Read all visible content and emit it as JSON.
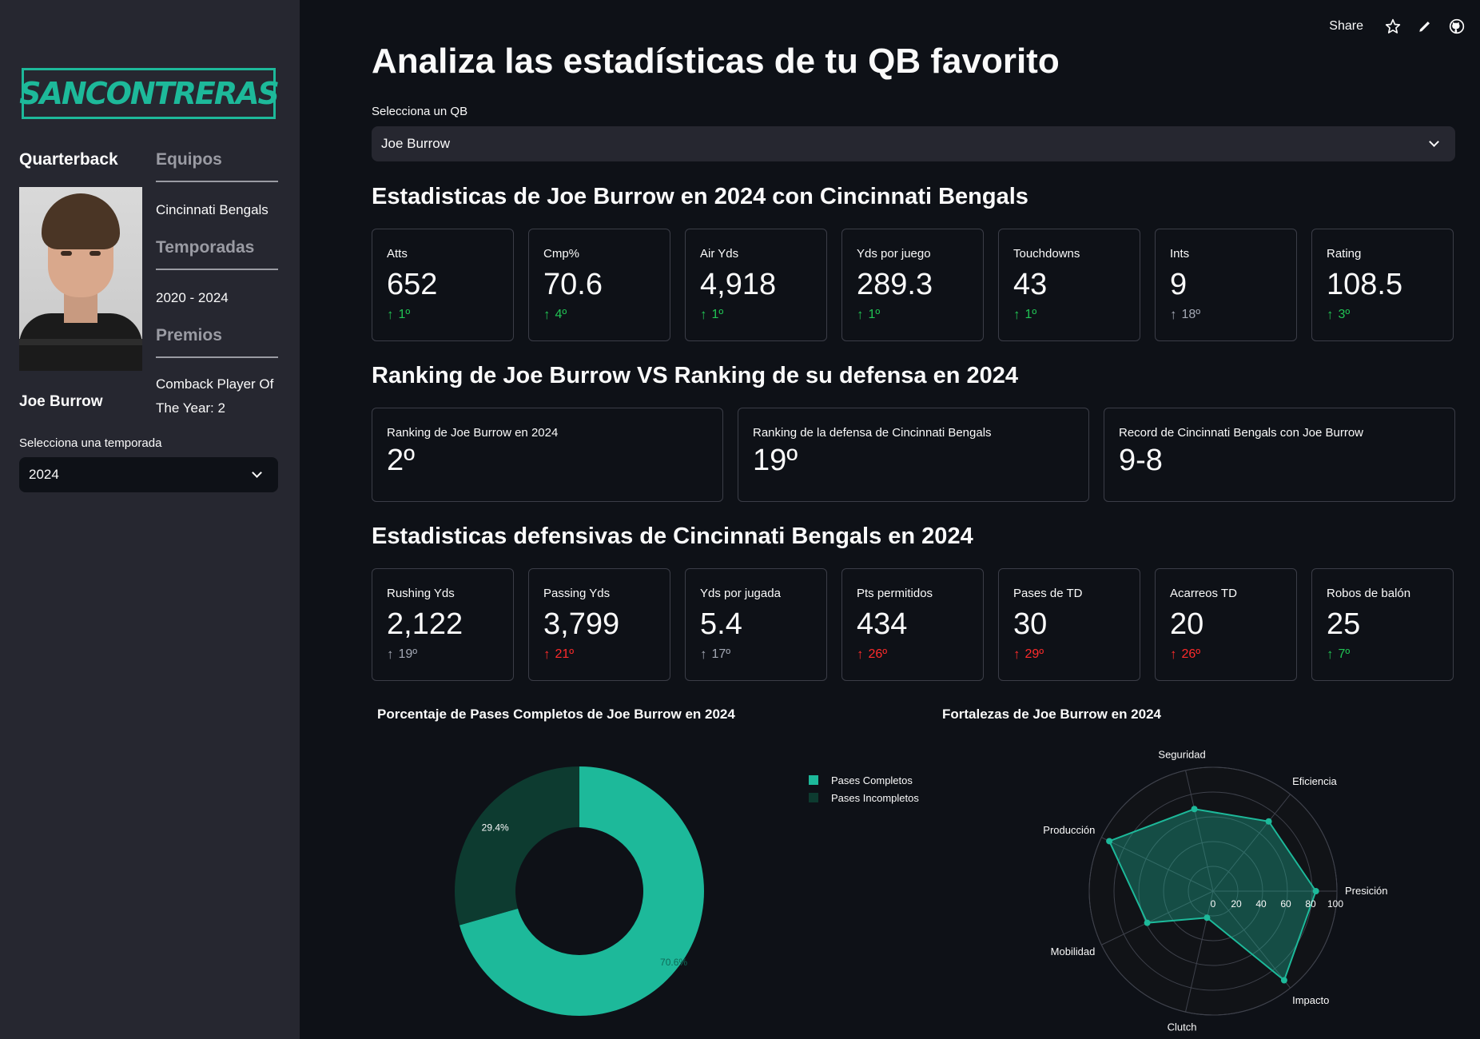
{
  "sidebar": {
    "logo_text": "SANCONTRERAS",
    "quarterback_heading": "Quarterback",
    "player_name": "Joe Burrow",
    "teams_heading": "Equipos",
    "team": "Cincinnati Bengals",
    "seasons_heading": "Temporadas",
    "seasons": "2020 - 2024",
    "awards_heading": "Premios",
    "award_line1": "Comback Player Of",
    "award_line2": "The Year: 2",
    "season_select_label": "Selecciona una temporada",
    "season_selected": "2024"
  },
  "topbar": {
    "share": "Share"
  },
  "main": {
    "title": "Analiza las estadísticas de tu QB favorito",
    "qb_select_label": "Selecciona un QB",
    "qb_selected": "Joe Burrow",
    "section1": "Estadisticas de Joe Burrow en 2024 con Cincinnati Bengals",
    "section2": "Ranking de Joe Burrow VS Ranking de su defensa en 2024",
    "section3": "Estadisticas defensivas de Cincinnati Bengals en 2024",
    "qb_stats": [
      {
        "label": "Atts",
        "value": "652",
        "delta": "1º",
        "color": "green"
      },
      {
        "label": "Cmp%",
        "value": "70.6",
        "delta": "4º",
        "color": "green"
      },
      {
        "label": "Air Yds",
        "value": "4,918",
        "delta": "1º",
        "color": "green"
      },
      {
        "label": "Yds por juego",
        "value": "289.3",
        "delta": "1º",
        "color": "green"
      },
      {
        "label": "Touchdowns",
        "value": "43",
        "delta": "1º",
        "color": "green"
      },
      {
        "label": "Ints",
        "value": "9",
        "delta": "18º",
        "color": "gray"
      },
      {
        "label": "Rating",
        "value": "108.5",
        "delta": "3º",
        "color": "green"
      }
    ],
    "rankings": [
      {
        "label": "Ranking de Joe Burrow en 2024",
        "value": "2º"
      },
      {
        "label": "Ranking de la defensa de Cincinnati Bengals",
        "value": "19º"
      },
      {
        "label": "Record de Cincinnati Bengals con Joe Burrow",
        "value": "9-8"
      }
    ],
    "def_stats": [
      {
        "label": "Rushing Yds",
        "value": "2,122",
        "delta": "19º",
        "color": "gray"
      },
      {
        "label": "Passing Yds",
        "value": "3,799",
        "delta": "21º",
        "color": "red"
      },
      {
        "label": "Yds por jugada",
        "value": "5.4",
        "delta": "17º",
        "color": "gray"
      },
      {
        "label": "Pts permitidos",
        "value": "434",
        "delta": "26º",
        "color": "red"
      },
      {
        "label": "Pases de TD",
        "value": "30",
        "delta": "29º",
        "color": "red"
      },
      {
        "label": "Acarreos TD",
        "value": "20",
        "delta": "26º",
        "color": "red"
      },
      {
        "label": "Robos de balón",
        "value": "25",
        "delta": "7º",
        "color": "green"
      }
    ]
  },
  "chart_data": [
    {
      "type": "pie",
      "title": "Porcentaje de Pases Completos de Joe Burrow en 2024",
      "categories": [
        "Pases Completos",
        "Pases Incompletos"
      ],
      "values": [
        70.6,
        29.4
      ],
      "labels": [
        "70.6%",
        "29.4%"
      ],
      "colors": [
        "#1db99a",
        "#0d3b30"
      ],
      "legend": "top-right",
      "hole": true
    },
    {
      "type": "radar",
      "title": "Fortalezas de Joe Burrow en 2024",
      "categories": [
        "Presición",
        "Eficiencia",
        "Seguridad",
        "Producción",
        "Mobilidad",
        "Clutch",
        "Impacto"
      ],
      "values": [
        83,
        72,
        68,
        93,
        59,
        22,
        92
      ],
      "radial_ticks": [
        "0",
        "20",
        "40",
        "60",
        "80",
        "100"
      ],
      "range": [
        0,
        100
      ],
      "color": "#1db99a"
    }
  ]
}
